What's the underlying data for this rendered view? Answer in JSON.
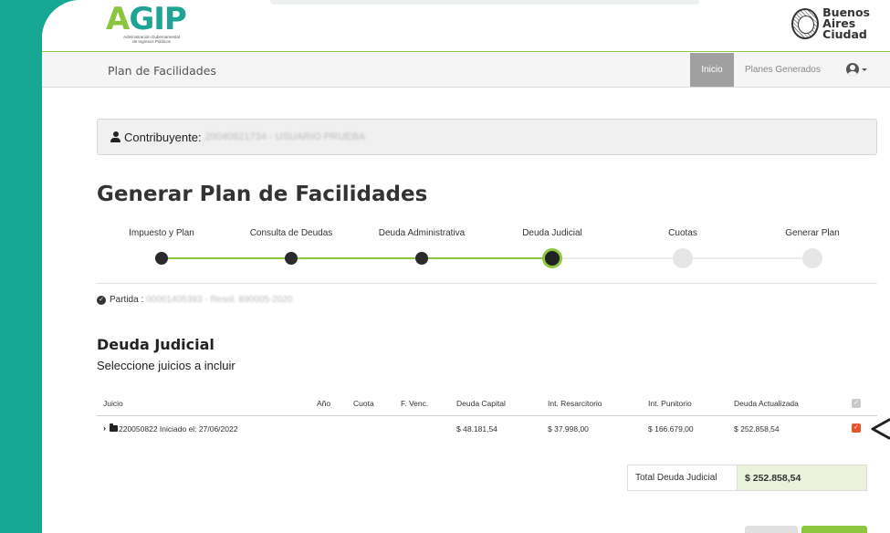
{
  "header": {
    "logo_text": "AGIP",
    "logo_subtitle_1": "Administración Gubernamental",
    "logo_subtitle_2": "de Ingresos Públicos",
    "city_line_1": "Buenos",
    "city_line_2": "Aires",
    "city_line_3": "Ciudad"
  },
  "navbar": {
    "brand": "Plan de Facilidades",
    "home": "Inicio",
    "generated_plans": "Planes Generados"
  },
  "contribuyente": {
    "label": "Contribuyente:",
    "value": "20040621734 - USUARIO PRUEBA"
  },
  "page_title": "Generar Plan de Facilidades",
  "steps": [
    {
      "label": "Impuesto y Plan",
      "state": "done"
    },
    {
      "label": "Consulta de Deudas",
      "state": "done"
    },
    {
      "label": "Deuda Administrativa",
      "state": "done"
    },
    {
      "label": "Deuda Judicial",
      "state": "current"
    },
    {
      "label": "Cuotas",
      "state": "pending"
    },
    {
      "label": "Generar Plan",
      "state": "pending"
    }
  ],
  "partida": {
    "label": "Partida :",
    "value": "00001405393 - Resol. 890005-2020"
  },
  "section": {
    "title": "Deuda Judicial",
    "subtitle": "Seleccione juicios a incluir"
  },
  "table": {
    "headers": {
      "juicio": "Juicio",
      "anio": "Año",
      "cuota": "Cuota",
      "fvenc": "F. Venc.",
      "capital": "Deuda Capital",
      "resarcitorio": "Int. Resarcitorio",
      "punitorio": "Int. Punitorio",
      "actualizada": "Deuda Actualizada"
    },
    "rows": [
      {
        "juicio": "220050822 Iniciado el: 27/06/2022",
        "anio": "",
        "cuota": "",
        "fvenc": "",
        "capital": "$ 48.181,54",
        "resarcitorio": "$ 37.998,00",
        "punitorio": "$ 166.679,00",
        "actualizada": "$ 252.858,54",
        "selected": true
      }
    ]
  },
  "total": {
    "label": "Total Deuda Judicial",
    "value": "$ 252.858,54"
  },
  "colors": {
    "background": "#17a894",
    "accent_green": "#8cc63f",
    "checkbox_orange": "#e8542d"
  }
}
